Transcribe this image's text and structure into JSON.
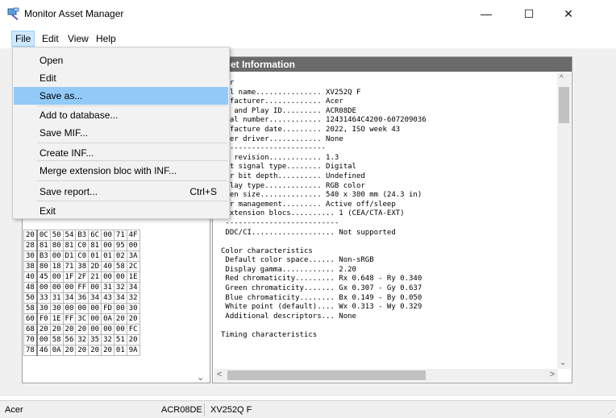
{
  "window": {
    "title": "Monitor Asset Manager",
    "minimize": "—",
    "maximize": "☐",
    "close": "✕"
  },
  "menubar": {
    "file": "File",
    "edit": "Edit",
    "view": "View",
    "help": "Help"
  },
  "file_menu": {
    "items": [
      {
        "label": "Open",
        "shortcut": ""
      },
      {
        "label": "Edit",
        "shortcut": ""
      },
      {
        "label": "Save as...",
        "shortcut": ""
      },
      {
        "label": "Add to database...",
        "shortcut": ""
      },
      {
        "label": "Save MIF...",
        "shortcut": ""
      },
      {
        "label": "Create INF...",
        "shortcut": ""
      },
      {
        "label": "Merge extension bloc with INF...",
        "shortcut": ""
      },
      {
        "label": "Save report...",
        "shortcut": "Ctrl+S"
      },
      {
        "label": "Exit",
        "shortcut": ""
      }
    ],
    "highlighted_index": 2
  },
  "hex_rows": [
    [
      "20",
      "0C",
      "50",
      "54",
      "B3",
      "6C",
      "00",
      "71",
      "4F"
    ],
    [
      "28",
      "81",
      "80",
      "81",
      "C0",
      "81",
      "00",
      "95",
      "00"
    ],
    [
      "30",
      "B3",
      "00",
      "D1",
      "C0",
      "01",
      "01",
      "02",
      "3A"
    ],
    [
      "38",
      "80",
      "18",
      "71",
      "38",
      "2D",
      "40",
      "58",
      "2C"
    ],
    [
      "40",
      "45",
      "00",
      "1F",
      "2F",
      "21",
      "00",
      "00",
      "1E"
    ],
    [
      "48",
      "00",
      "00",
      "00",
      "FF",
      "00",
      "31",
      "32",
      "34"
    ],
    [
      "50",
      "33",
      "31",
      "34",
      "36",
      "34",
      "43",
      "34",
      "32"
    ],
    [
      "58",
      "30",
      "30",
      "00",
      "00",
      "00",
      "FD",
      "00",
      "30"
    ],
    [
      "60",
      "F0",
      "1E",
      "FF",
      "3C",
      "00",
      "0A",
      "20",
      "20"
    ],
    [
      "68",
      "20",
      "20",
      "20",
      "20",
      "00",
      "00",
      "00",
      "FC"
    ],
    [
      "70",
      "00",
      "58",
      "56",
      "32",
      "35",
      "32",
      "51",
      "20"
    ],
    [
      "78",
      "46",
      "0A",
      "20",
      "20",
      "20",
      "20",
      "01",
      "9A"
    ]
  ],
  "info_panel": {
    "header": "et Information",
    "lines": [
      "tor",
      "del name............... XV252Q F",
      "nufacturer............. Acer",
      "ug and Play ID......... ACR08DE",
      "rial number............ 12431464C4200-607209036",
      "nufacture date......... 2022, ISO week 43",
      "lter driver............ None",
      "------------------------",
      "ID revision............ 1.3",
      "put signal type........ Digital",
      "lor bit depth.......... Undefined",
      "splay type............. RGB color",
      "reen size.............. 540 x 300 mm (24.3 in)",
      "wer management......... Active off/sleep",
      " Extension blocs.......... 1 (CEA/CTA-EXT)",
      " --------------------------",
      " DDC/CI................... Not supported",
      "",
      "Color characteristics",
      " Default color space...... Non-sRGB",
      " Display gamma............ 2.20",
      " Red chromaticity......... Rx 0.648 - Ry 0.340",
      " Green chromaticity....... Gx 0.307 - Gy 0.637",
      " Blue chromaticity........ Bx 0.149 - By 0.050",
      " White point (default).... Wx 0.313 - Wy 0.329",
      " Additional descriptors... None",
      "",
      "Timing characteristics"
    ]
  },
  "statusbar": {
    "manufacturer": "Acer",
    "pnp_id": "ACR08DE",
    "model": "XV252Q F"
  },
  "colors": {
    "menu_highlight": "#91c9f7",
    "header_bg": "#6a6a6a",
    "active_menu": "#cce8ff"
  }
}
